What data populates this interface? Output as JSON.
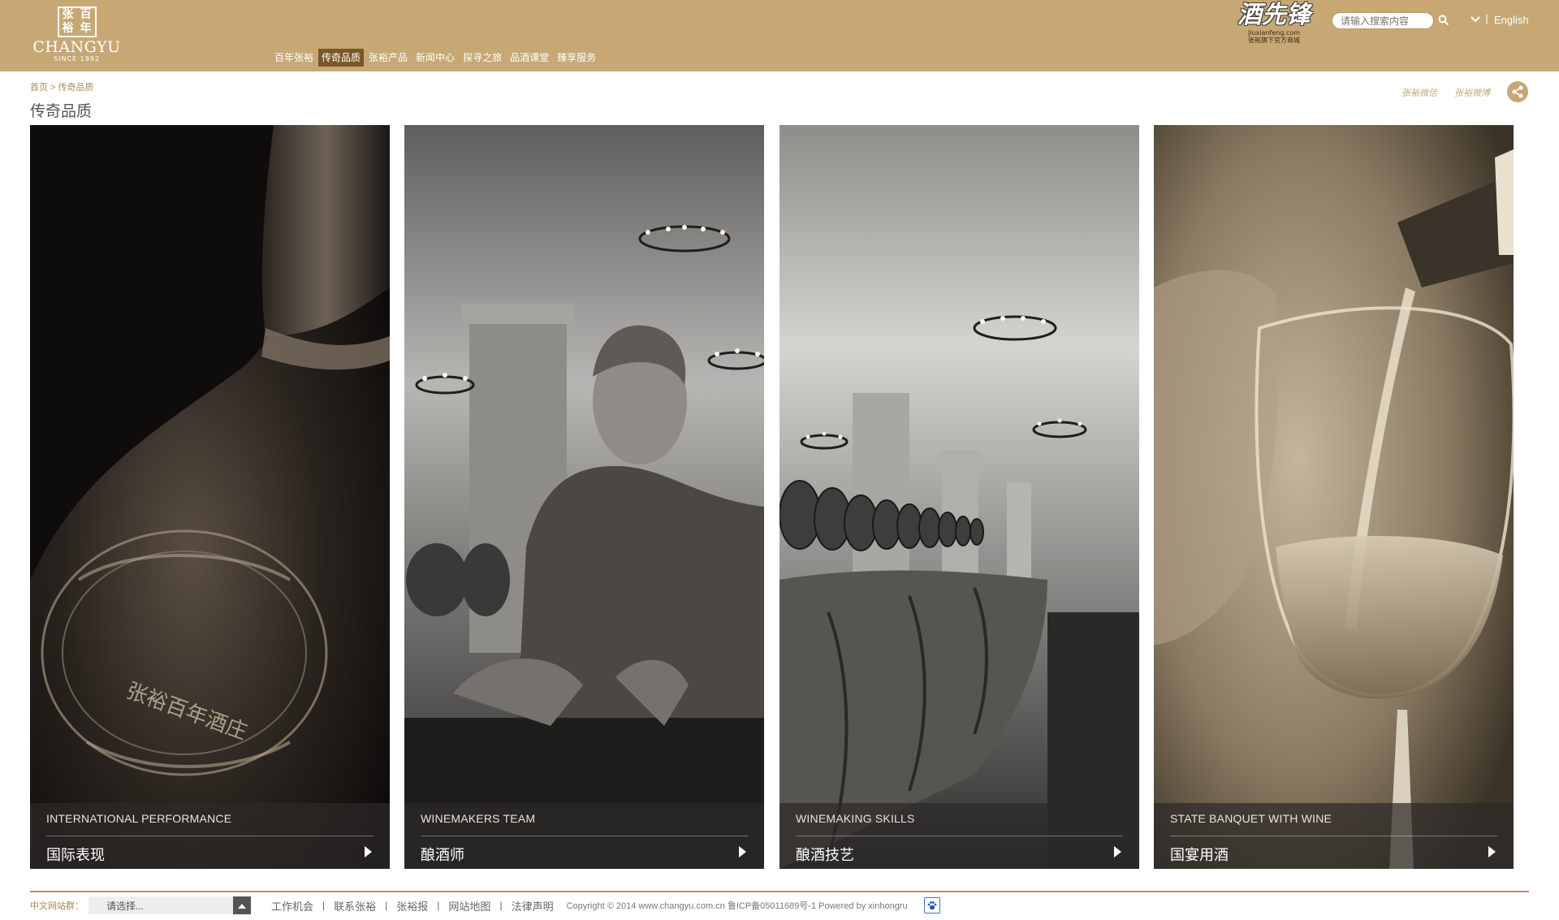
{
  "header": {
    "logo": {
      "seal_chars": [
        "张",
        "百",
        "裕",
        "年"
      ],
      "name": "CHANGYU",
      "since": "SINCE 1892"
    },
    "nav": [
      {
        "label": "百年张裕",
        "active": false
      },
      {
        "label": "传奇品质",
        "active": true
      },
      {
        "label": "张裕产品",
        "active": false
      },
      {
        "label": "新闻中心",
        "active": false
      },
      {
        "label": "探寻之旅",
        "active": false
      },
      {
        "label": "品酒课堂",
        "active": false
      },
      {
        "label": "臻享服务",
        "active": false
      }
    ],
    "shop_logo": {
      "title": "酒先锋",
      "url_text": "Jiuxianfeng.com",
      "subtitle": "张裕旗下官方商城"
    },
    "search": {
      "placeholder": "请输入搜索内容"
    },
    "lang_sep": "|",
    "language": "English"
  },
  "breadcrumb": {
    "home": "首页",
    "sep": " > ",
    "current": "传奇品质"
  },
  "page_title": "传奇品质",
  "social": {
    "wechat": "张裕微信",
    "weibo": "张裕微博"
  },
  "panels": [
    {
      "en": "INTERNATIONAL PERFORMANCE",
      "cn": "国际表现",
      "label_text": "張裕百年酒庄"
    },
    {
      "en": "WINEMAKERS TEAM",
      "cn": "酿酒师"
    },
    {
      "en": "WINEMAKING SKILLS",
      "cn": "酿酒技艺"
    },
    {
      "en": "STATE BANQUET WITH WINE",
      "cn": "国宴用酒"
    }
  ],
  "footer": {
    "site_group_label": "中文网站群：",
    "site_select": "请选择...",
    "links": [
      "工作机会",
      "联系张裕",
      "张裕报",
      "网站地图",
      "法律声明"
    ],
    "link_sep": "|",
    "copyright": "Copyright © 2014 www.changyu.com.cn   鲁ICP备05011689号-1   Powered by xinhongru"
  },
  "colors": {
    "header_bg": "#c7a875",
    "nav_active": "#7a5727",
    "footer_line": "#b38f5c",
    "caption_bg": "rgba(45,42,40,0.72)"
  }
}
